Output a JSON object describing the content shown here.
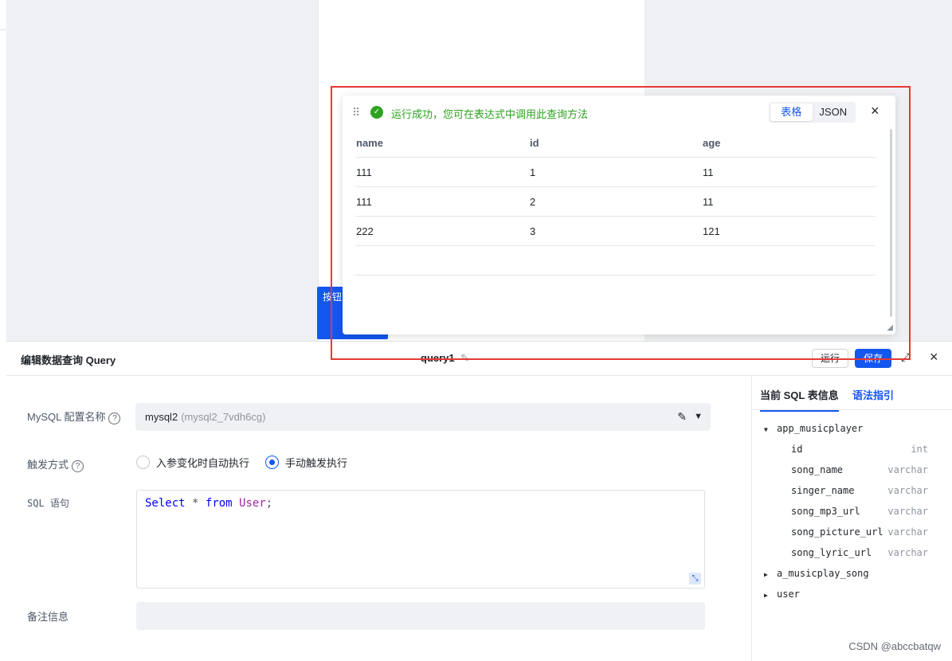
{
  "canvas": {
    "button_label": "按钮"
  },
  "editor": {
    "title": "编辑数据查询 Query",
    "query_name": "query1",
    "run_label": "运行",
    "save_label": "保存",
    "fields": {
      "config_label": "MySQL 配置名称",
      "config_value": "mysql2",
      "config_sub": "(mysql2_7vdh6cg)",
      "trigger_label": "触发方式",
      "trigger_options": [
        {
          "label": "入参变化时自动执行",
          "checked": false
        },
        {
          "label": "手动触发执行",
          "checked": true
        }
      ],
      "sql_label": "SQL 语句",
      "sql_tokens": {
        "select": "Select",
        "star": "*",
        "from": "from",
        "table": "User",
        "semicolon": ";"
      },
      "note_label": "备注信息",
      "note_value": ""
    }
  },
  "schema": {
    "tabs": [
      "当前 SQL 表信息",
      "语法指引"
    ],
    "tables": [
      {
        "name": "app_musicplayer",
        "expanded": true,
        "columns": [
          {
            "name": "id",
            "type": "int"
          },
          {
            "name": "song_name",
            "type": "varchar"
          },
          {
            "name": "singer_name",
            "type": "varchar"
          },
          {
            "name": "song_mp3_url",
            "type": "varchar"
          },
          {
            "name": "song_picture_url",
            "type": "varchar"
          },
          {
            "name": "song_lyric_url",
            "type": "varchar"
          }
        ]
      },
      {
        "name": "a_musicplay_song",
        "expanded": false
      },
      {
        "name": "user",
        "expanded": false
      }
    ]
  },
  "result": {
    "message": "运行成功，您可在表达式中调用此查询方法",
    "view_tabs": [
      "表格",
      "JSON"
    ],
    "active_view": "表格",
    "columns": [
      "name",
      "id",
      "age"
    ],
    "rows": [
      [
        "111",
        "1",
        "11"
      ],
      [
        "111",
        "2",
        "11"
      ],
      [
        "222",
        "3",
        "121"
      ]
    ]
  },
  "watermark": "CSDN @abccbatqw",
  "colors": {
    "accent": "#1456f0",
    "success": "#2ea121",
    "highlight": "#e53935"
  }
}
